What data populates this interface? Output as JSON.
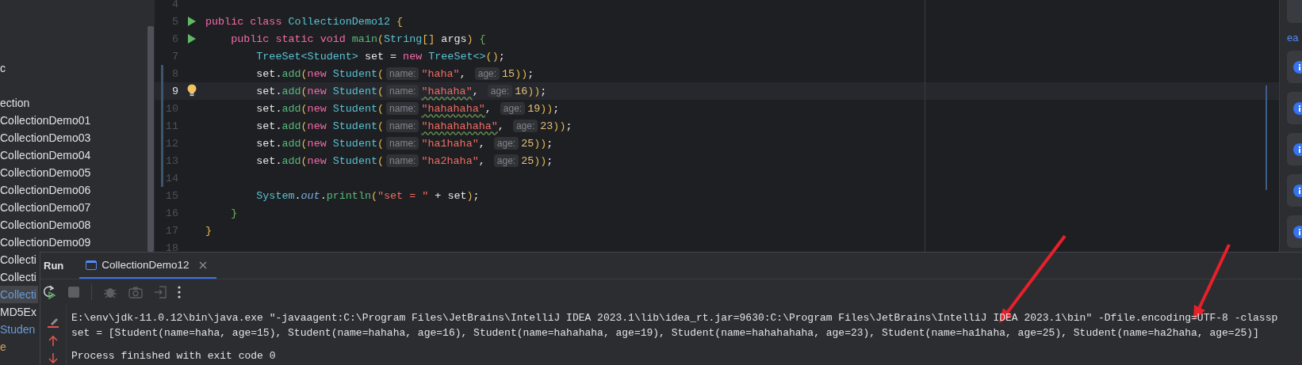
{
  "sidebar": {
    "items": [
      {
        "label": "c",
        "selected": false,
        "color": "#dfe1e5"
      },
      {
        "label": "ection",
        "selected": false,
        "color": "#dfe1e5"
      },
      {
        "label": "CollectionDemo01",
        "selected": false,
        "color": "#dfe1e5"
      },
      {
        "label": "CollectionDemo03",
        "selected": false,
        "color": "#dfe1e5"
      },
      {
        "label": "CollectionDemo04",
        "selected": false,
        "color": "#dfe1e5"
      },
      {
        "label": "CollectionDemo05",
        "selected": false,
        "color": "#dfe1e5"
      },
      {
        "label": "CollectionDemo06",
        "selected": false,
        "color": "#dfe1e5"
      },
      {
        "label": "CollectionDemo07",
        "selected": false,
        "color": "#dfe1e5"
      },
      {
        "label": "CollectionDemo08",
        "selected": false,
        "color": "#dfe1e5"
      },
      {
        "label": "CollectionDemo09",
        "selected": false,
        "color": "#dfe1e5"
      },
      {
        "label": "Collecti",
        "selected": false,
        "color": "#dfe1e5"
      },
      {
        "label": "Collecti",
        "selected": false,
        "color": "#dfe1e5"
      },
      {
        "label": "Collecti",
        "selected": true,
        "color": "#6b9bd8"
      },
      {
        "label": "MD5Ex",
        "selected": false,
        "color": "#dfe1e5"
      },
      {
        "label": "Studen",
        "selected": false,
        "color": "#6b9bd8"
      },
      {
        "label": "e",
        "selected": false,
        "color": "#d6a05c"
      }
    ]
  },
  "editor": {
    "lines": [
      {
        "number": "4",
        "current": false,
        "changed": false
      },
      {
        "number": "5",
        "current": false,
        "changed": false,
        "gutter_icon": {
          "kind": "run"
        },
        "tokens": [
          {
            "kind": "keyword",
            "text": "public class "
          },
          {
            "kind": "type",
            "text": "CollectionDemo12 "
          },
          {
            "kind": "paren",
            "text": "{"
          }
        ]
      },
      {
        "number": "6",
        "current": false,
        "changed": false,
        "gutter_icon": {
          "kind": "run"
        },
        "tokens": [
          {
            "kind": "keyword",
            "text": "    public static void "
          },
          {
            "kind": "function",
            "text": "main"
          },
          {
            "kind": "paren",
            "text": "("
          },
          {
            "kind": "type",
            "text": "String"
          },
          {
            "kind": "paren",
            "text": "[]"
          },
          {
            "kind": "plain",
            "text": " args"
          },
          {
            "kind": "paren",
            "text": ") "
          },
          {
            "kind": "brace",
            "text": "{"
          }
        ]
      },
      {
        "number": "7",
        "current": false,
        "changed": false,
        "tokens": [
          {
            "kind": "type",
            "text": "        TreeSet<Student>"
          },
          {
            "kind": "plain",
            "text": " set = "
          },
          {
            "kind": "keyword",
            "text": "new "
          },
          {
            "kind": "type",
            "text": "TreeSet<>"
          },
          {
            "kind": "paren",
            "text": "()"
          },
          {
            "kind": "plain",
            "text": ";"
          }
        ]
      },
      {
        "number": "8",
        "current": false,
        "changed": true,
        "tokens": [
          {
            "kind": "plain",
            "text": "        set."
          },
          {
            "kind": "function",
            "text": "add"
          },
          {
            "kind": "paren",
            "text": "("
          },
          {
            "kind": "keyword",
            "text": "new "
          },
          {
            "kind": "type",
            "text": "Student"
          },
          {
            "kind": "paren",
            "text": "("
          },
          {
            "kind": "hint",
            "text": "name:"
          },
          {
            "kind": "string",
            "text": "\"haha\""
          },
          {
            "kind": "plain",
            "text": ", "
          },
          {
            "kind": "hint",
            "text": "age:"
          },
          {
            "kind": "number",
            "text": "15"
          },
          {
            "kind": "paren",
            "text": "))"
          },
          {
            "kind": "plain",
            "text": ";"
          }
        ]
      },
      {
        "number": "9",
        "current": true,
        "changed": true,
        "gutter_icon": {
          "kind": "bulb"
        },
        "tokens": [
          {
            "kind": "plain",
            "text": "        set."
          },
          {
            "kind": "function",
            "text": "add"
          },
          {
            "kind": "paren",
            "text": "("
          },
          {
            "kind": "keyword",
            "text": "new "
          },
          {
            "kind": "type",
            "text": "Student"
          },
          {
            "kind": "paren",
            "text": "("
          },
          {
            "kind": "hint",
            "text": "name:"
          },
          {
            "kind": "string",
            "text": "\"hahaha\"",
            "typo": true
          },
          {
            "kind": "plain",
            "text": ", "
          },
          {
            "kind": "hint",
            "text": "age:"
          },
          {
            "kind": "number",
            "text": "16"
          },
          {
            "kind": "paren",
            "text": "))"
          },
          {
            "kind": "plain",
            "text": ";"
          }
        ]
      },
      {
        "number": "10",
        "current": false,
        "changed": true,
        "tokens": [
          {
            "kind": "plain",
            "text": "        set."
          },
          {
            "kind": "function",
            "text": "add"
          },
          {
            "kind": "paren",
            "text": "("
          },
          {
            "kind": "keyword",
            "text": "new "
          },
          {
            "kind": "type",
            "text": "Student"
          },
          {
            "kind": "paren",
            "text": "("
          },
          {
            "kind": "hint",
            "text": "name:"
          },
          {
            "kind": "string",
            "text": "\"hahahaha\"",
            "typo": true
          },
          {
            "kind": "plain",
            "text": ", "
          },
          {
            "kind": "hint",
            "text": "age:"
          },
          {
            "kind": "number",
            "text": "19"
          },
          {
            "kind": "paren",
            "text": "))"
          },
          {
            "kind": "plain",
            "text": ";"
          }
        ]
      },
      {
        "number": "11",
        "current": false,
        "changed": true,
        "tokens": [
          {
            "kind": "plain",
            "text": "        set."
          },
          {
            "kind": "function",
            "text": "add"
          },
          {
            "kind": "paren",
            "text": "("
          },
          {
            "kind": "keyword",
            "text": "new "
          },
          {
            "kind": "type",
            "text": "Student"
          },
          {
            "kind": "paren",
            "text": "("
          },
          {
            "kind": "hint",
            "text": "name:"
          },
          {
            "kind": "string",
            "text": "\"hahahahaha\"",
            "typo": true
          },
          {
            "kind": "plain",
            "text": ", "
          },
          {
            "kind": "hint",
            "text": "age:"
          },
          {
            "kind": "number",
            "text": "23"
          },
          {
            "kind": "paren",
            "text": "))"
          },
          {
            "kind": "plain",
            "text": ";"
          }
        ]
      },
      {
        "number": "12",
        "current": false,
        "changed": true,
        "tokens": [
          {
            "kind": "plain",
            "text": "        set."
          },
          {
            "kind": "function",
            "text": "add"
          },
          {
            "kind": "paren",
            "text": "("
          },
          {
            "kind": "keyword",
            "text": "new "
          },
          {
            "kind": "type",
            "text": "Student"
          },
          {
            "kind": "paren",
            "text": "("
          },
          {
            "kind": "hint",
            "text": "name:"
          },
          {
            "kind": "string",
            "text": "\"ha1haha\""
          },
          {
            "kind": "plain",
            "text": ", "
          },
          {
            "kind": "hint",
            "text": "age:"
          },
          {
            "kind": "number",
            "text": "25"
          },
          {
            "kind": "paren",
            "text": "))"
          },
          {
            "kind": "plain",
            "text": ";"
          }
        ]
      },
      {
        "number": "13",
        "current": false,
        "changed": true,
        "tokens": [
          {
            "kind": "plain",
            "text": "        set."
          },
          {
            "kind": "function",
            "text": "add"
          },
          {
            "kind": "paren",
            "text": "("
          },
          {
            "kind": "keyword",
            "text": "new "
          },
          {
            "kind": "type",
            "text": "Student"
          },
          {
            "kind": "paren",
            "text": "("
          },
          {
            "kind": "hint",
            "text": "name:"
          },
          {
            "kind": "string",
            "text": "\"ha2haha\""
          },
          {
            "kind": "plain",
            "text": ", "
          },
          {
            "kind": "hint",
            "text": "age:"
          },
          {
            "kind": "number",
            "text": "25"
          },
          {
            "kind": "paren",
            "text": "))"
          },
          {
            "kind": "plain",
            "text": ";"
          }
        ]
      },
      {
        "number": "14",
        "current": false,
        "changed": true
      },
      {
        "number": "15",
        "current": false,
        "changed": false,
        "tokens": [
          {
            "kind": "type",
            "text": "        System"
          },
          {
            "kind": "plain",
            "text": "."
          },
          {
            "kind": "field",
            "text": "out"
          },
          {
            "kind": "plain",
            "text": "."
          },
          {
            "kind": "function",
            "text": "println"
          },
          {
            "kind": "paren",
            "text": "("
          },
          {
            "kind": "string",
            "text": "\"set = \""
          },
          {
            "kind": "plain",
            "text": " + set"
          },
          {
            "kind": "paren",
            "text": ")"
          },
          {
            "kind": "plain",
            "text": ";"
          }
        ]
      },
      {
        "number": "16",
        "current": false,
        "changed": false,
        "tokens": [
          {
            "kind": "brace",
            "text": "    }"
          }
        ]
      },
      {
        "number": "17",
        "current": false,
        "changed": false,
        "tokens": [
          {
            "kind": "paren",
            "text": "}"
          }
        ]
      },
      {
        "number": "18",
        "current": false,
        "changed": false
      }
    ]
  },
  "notifications": {
    "label": "ea"
  },
  "run_panel": {
    "title": "Run",
    "tabs": [
      {
        "label": "CollectionDemo12",
        "selected": true
      }
    ],
    "toolbar": [
      {
        "kind": "rerun",
        "disabled": false
      },
      {
        "kind": "stop",
        "disabled": true
      },
      {
        "kind": "separator"
      },
      {
        "kind": "debug",
        "disabled": true
      },
      {
        "kind": "camera",
        "disabled": true
      },
      {
        "kind": "exit",
        "disabled": true
      },
      {
        "kind": "more",
        "disabled": false
      }
    ],
    "console": {
      "lines": [
        {
          "kind": "text",
          "text": "E:\\env\\jdk-11.0.12\\bin\\java.exe \"-javaagent:C:\\Program Files\\JetBrains\\IntelliJ IDEA 2023.1\\lib\\idea_rt.jar=9630:C:\\Program Files\\JetBrains\\IntelliJ IDEA 2023.1\\bin\" -Dfile.encoding=UTF-8 -classp"
        },
        {
          "kind": "text",
          "text": "set = [Student(name=haha, age=15), Student(name=hahaha, age=16), Student(name=hahahaha, age=19), Student(name=hahahahaha, age=23), Student(name=ha1haha, age=25), Student(name=ha2haha, age=25)]"
        },
        {
          "kind": "blank"
        },
        {
          "kind": "text",
          "text": "Process finished with exit code 0"
        }
      ]
    }
  }
}
